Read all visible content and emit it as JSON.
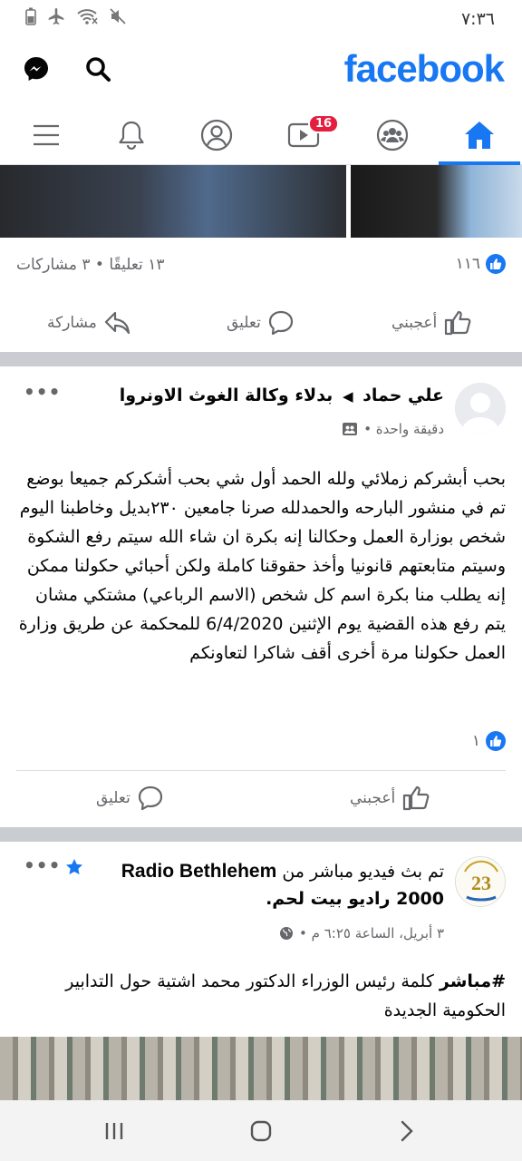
{
  "status_bar": {
    "time": "٧:٣٦"
  },
  "header": {
    "logo": "facebook",
    "icons": [
      "messenger-icon",
      "search-icon"
    ]
  },
  "tabs": [
    {
      "name": "home",
      "icon": "home-icon",
      "active": true
    },
    {
      "name": "groups",
      "icon": "groups-icon"
    },
    {
      "name": "watch",
      "icon": "video-icon",
      "badge": "16"
    },
    {
      "name": "profile",
      "icon": "profile-icon"
    },
    {
      "name": "notifications",
      "icon": "bell-icon"
    },
    {
      "name": "menu",
      "icon": "menu-icon"
    }
  ],
  "post1": {
    "likes": "١١٦",
    "comments_shares": "١٣ تعليقًا • ٣ مشاركات",
    "like_label": "أعجبني",
    "comment_label": "تعليق",
    "share_label": "مشاركة"
  },
  "post2": {
    "author": "علي حماد",
    "group": "بدلاء وكالة الغوث الاونروا",
    "time": "دقيقة واحدة •",
    "more": "•••",
    "text": "بحب أبشركم زملائي ولله الحمد أول شي بحب أشكركم جميعا بوضع تم في منشور البارحه والحمدلله صرنا جامعين ٢٣٠بديل وخاطبنا اليوم شخص بوزارة العمل وحكالنا إنه بكرة ان شاء الله سيتم رفع الشكوة وسيتم متابعتهم قانونيا وأخذ حقوقنا كاملة ولكن أحبائي حكولنا ممكن إنه يطلب منا بكرة اسم كل شخص (الاسم الرباعي) مشتكي مشان يتم رفع هذه القضية يوم الإثنين 6/4/2020 للمحكمة عن طريق وزارة العمل حكولنا مرة أخرى أقف شاكرا لتعاونكم",
    "likes": "١",
    "like_label": "أعجبني",
    "comment_label": "تعليق"
  },
  "post3": {
    "prefix": "تم بث فيديو مباشر من",
    "page_name": "Radio Bethlehem",
    "page_name2": "2000 راديو بيت لحم.",
    "time": "٣ أبريل، الساعة ٦:٢٥ م •",
    "hashtag": "#مباشر",
    "text": "كلمة رئيس الوزراء الدكتور محمد اشتية حول التدابير الحكومية الجديدة",
    "avatar_text": "23",
    "more": "•••"
  },
  "colors": {
    "accent": "#1877f2",
    "badge": "#e41e3f",
    "separator": "#c9ccd1"
  }
}
